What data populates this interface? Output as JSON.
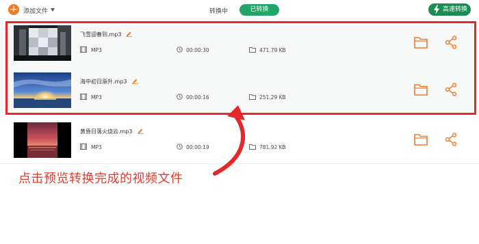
{
  "toolbar": {
    "add_icon": "plus-icon",
    "add_label": "添加文件",
    "tab_converting": "转换中",
    "tab_converted": "已转换",
    "fast_convert_label": "高速转换",
    "accent_color": "#f07c26",
    "active_tab_color": "#22a568"
  },
  "files": [
    {
      "name": "飞雪迎春到.mp3",
      "format": "MP3",
      "duration": "00:00:30",
      "size": "471.79 KB"
    },
    {
      "name": "海中初日渐升.mp3",
      "format": "MP3",
      "duration": "00:00:16",
      "size": "251.29 KB"
    },
    {
      "name": "黄昏日落火烧云.mp3",
      "format": "MP3",
      "duration": "00:00:19",
      "size": "781.92 KB"
    }
  ],
  "annotation": {
    "text": "点击预览转换完成的视频文件",
    "color": "#e53a2e"
  }
}
